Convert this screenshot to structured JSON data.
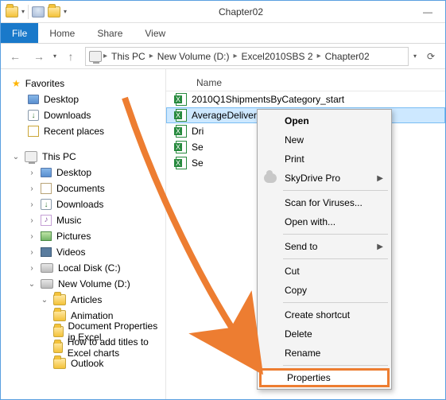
{
  "window": {
    "title": "Chapter02"
  },
  "ribbon": {
    "file": "File",
    "tabs": [
      "Home",
      "Share",
      "View"
    ]
  },
  "breadcrumb": [
    "This PC",
    "New Volume (D:)",
    "Excel2010SBS 2",
    "Chapter02"
  ],
  "sidebar": {
    "favorites": {
      "label": "Favorites",
      "items": [
        "Desktop",
        "Downloads",
        "Recent places"
      ]
    },
    "thispc": {
      "label": "This PC",
      "items": [
        "Desktop",
        "Documents",
        "Downloads",
        "Music",
        "Pictures",
        "Videos",
        "Local Disk (C:)"
      ],
      "newvol": {
        "label": "New Volume (D:)",
        "articles": {
          "label": "Articles",
          "items": [
            "Animation",
            "Document Properties in Excel",
            "How to add titles to Excel charts",
            "Outlook"
          ]
        }
      }
    }
  },
  "columns": {
    "name": "Name"
  },
  "files": [
    {
      "name": "2010Q1ShipmentsByCategory_start",
      "selected": false,
      "trunc": "2010Q1ShipmentsByCategory_start"
    },
    {
      "name": "AverageDeliveries_start",
      "selected": true,
      "trunc": "AverageDeliveries_start"
    },
    {
      "name": "Dri",
      "selected": false,
      "trunc": "Dri"
    },
    {
      "name": "Se",
      "selected": false,
      "trunc": "Se"
    },
    {
      "name": "Se",
      "selected": false,
      "trunc": "Se"
    }
  ],
  "context_menu": {
    "open": "Open",
    "new": "New",
    "print": "Print",
    "skydrive": "SkyDrive Pro",
    "scan": "Scan for Viruses...",
    "openwith": "Open with...",
    "sendto": "Send to",
    "cut": "Cut",
    "copy": "Copy",
    "shortcut": "Create shortcut",
    "delete": "Delete",
    "rename": "Rename",
    "properties": "Properties"
  },
  "colors": {
    "accent": "#1979ca",
    "highlight": "#ed7d31",
    "selection": "#cde8ff"
  }
}
